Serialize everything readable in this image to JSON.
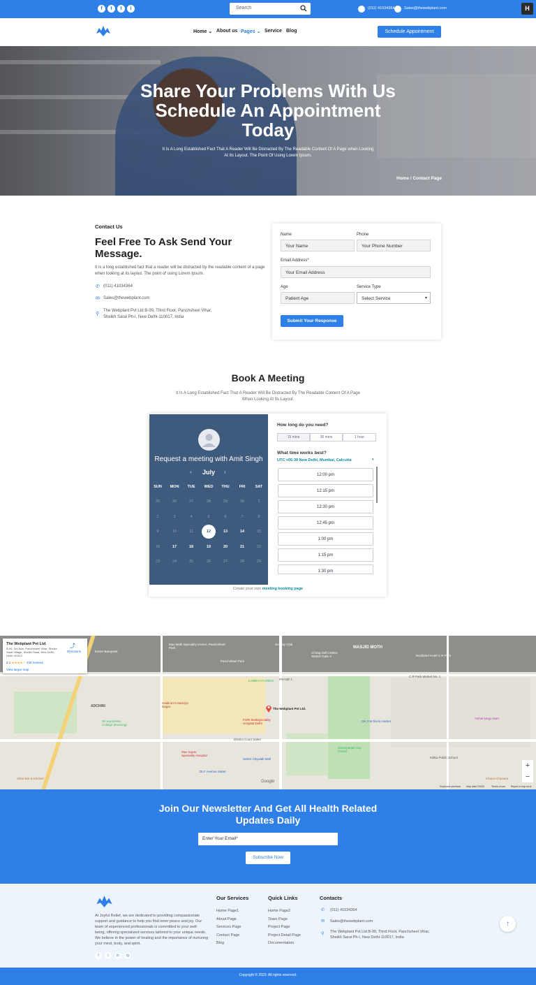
{
  "topbar": {
    "social": [
      "f",
      "t",
      "t",
      "i"
    ],
    "search_placeholder": "Search",
    "phone": "(011) 41034364",
    "email": "Sales@thewebplant.com",
    "hubspot": "H"
  },
  "nav": {
    "items": [
      "Home",
      "About us",
      "Pages",
      "Service",
      "Blog"
    ],
    "schedule_button": "Schedule Appointment"
  },
  "hero": {
    "title": "Share Your Problems With Us Schedule An Appointment Today",
    "subtitle": "It Is A Long Established Fact That A Reader Will Be Distracted By The Readable Content Of A Page when Looking At Its Layout. The Point Of Using Lorem Ipsum.",
    "breadcrumb_home": "Home",
    "breadcrumb_current": "Contact Page"
  },
  "contact": {
    "label": "Contact Us",
    "title": "Feel Free To Ask Send Your Message.",
    "description": "It is a long established fact that a reader will be distracted by the readable content of a page when looking at its layout. The point of using Lorem Ipsum.",
    "phone": "(011) 41034364",
    "email": "Sales@thewebplant.com",
    "address": "The Webplant Pvt Ltd B-99, Third Floor, Panchsheel Vihar, Sheikh Sarai Ph-I, New Delhi-110017, India"
  },
  "form": {
    "name_label": "Name",
    "name_value": "Your Name",
    "phone_label": "Phone",
    "phone_value": "Your Phone Number",
    "email_label": "Email Address*",
    "email_value": "Your Email Address",
    "age_label": "Age",
    "age_value": "Patient Age",
    "service_label": "Service Type",
    "service_value": "Select Service",
    "submit": "Submit Your Response"
  },
  "meeting": {
    "title": "Book A Meeting",
    "subtitle": "It Is A Long Established Fact That A Reader Will Be Distracted By The Readable Content Of A Page When Looking At Its Layout.",
    "request": "Request a meeting with Amit Singh",
    "month": "July",
    "weekdays": [
      "SUN",
      "MON",
      "TUE",
      "WED",
      "THU",
      "FRI",
      "SAT"
    ],
    "how_long": "How long do you need?",
    "durations": [
      "15 mins",
      "30 mins",
      "1 hour"
    ],
    "what_time": "What time works best?",
    "timezone": "UTC +05:30 New Delhi, Mumbai, Calcutta",
    "slots": [
      "12:00 pm",
      "12:15 pm",
      "12:30 pm",
      "12:45 pm",
      "1:00 pm",
      "1:15 pm",
      "1:30 pm"
    ],
    "powered_prefix": "Create your own",
    "powered_link": "meeting booking page"
  },
  "map": {
    "card_title": "The Webplant Pvt Ltd.",
    "card_address": "B-99, 3rd floor, Panchsheel Vihar, Sheikh Sarai Village, Sheikh Sarai, New Delhi, Delhi 110017",
    "rating": "4.1",
    "stars": "★★★★☆",
    "reviews": "236 reviews",
    "larger_map": "View larger map",
    "directions": "Directions",
    "labels": [
      "Essex Banquets",
      "Max Multi Speciality Centre, Panchsheel Park",
      "Panchsheel Park",
      "Holiday Club",
      "MASJID MOTH",
      "Chirag Delhi Metro Station Gate 4",
      "Rockland Hotel C R Park",
      "PHASE 1",
      "LAMBA HYUNDAI",
      "ADCHINI",
      "Sri Aurobindo College (Evening)",
      "Haldiram's Malviya Nagar",
      "The Webplant Pvt Ltd.",
      "PSRI Multispeciality Hospital Delhi",
      "District Court Saket",
      "Max Super Speciality Hospital",
      "Select Citywalk Mall",
      "DLF Avenue Saket",
      "GK 2 M block market",
      "Jahanpanah City Forest",
      "C R Park Market No. 1",
      "Vishal Mega Mart",
      "Kalka Public School",
      "Olive Bar & Kitchen",
      "Khana Khazana",
      "Google",
      "Keyboard shortcuts",
      "Map data ©2023",
      "Terms of use",
      "Report a map error"
    ],
    "zoom_in": "+",
    "zoom_out": "−"
  },
  "newsletter": {
    "title": "Join Our Newsletter And Get All Health Related Updates Daily",
    "placeholder": "Enter Your Email*",
    "button": "Subscribe Now"
  },
  "footer": {
    "description": "At Joyful Relief, we are dedicated to providing compassionate support and guidance to help you find inner peace and joy. Our team of experienced professionals is committed to your well-being, offering specialized services tailored to your unique needs. We believe in the power of healing and the importance of nurturing your mind, body, and spirit.",
    "social": [
      "f",
      "t",
      "in",
      "ig"
    ],
    "services_title": "Our Services",
    "services": [
      "Home Page1",
      "About Page",
      "Services Page",
      "Contact Page",
      "Blog"
    ],
    "quick_title": "Quick Links",
    "quick": [
      "Home Page2",
      "Team Page",
      "Project Page",
      "Project Detail Page",
      "Documentation"
    ],
    "contacts_title": "Contacts",
    "phone": "(011) 41034364",
    "email": "Sales@thewebplant.com",
    "address": "The Webplant Pvt Ltd B-99, Third Floor, Panchsheel Vihar, Sheikh Sarai Ph-I, New Delhi-110017, India",
    "copyright": "Copyright © 2023. All rights reserved."
  },
  "colors": {
    "primary": "#2e7fe8",
    "calendar": "#3e5a7c",
    "footer_bg": "#eef4fc"
  }
}
